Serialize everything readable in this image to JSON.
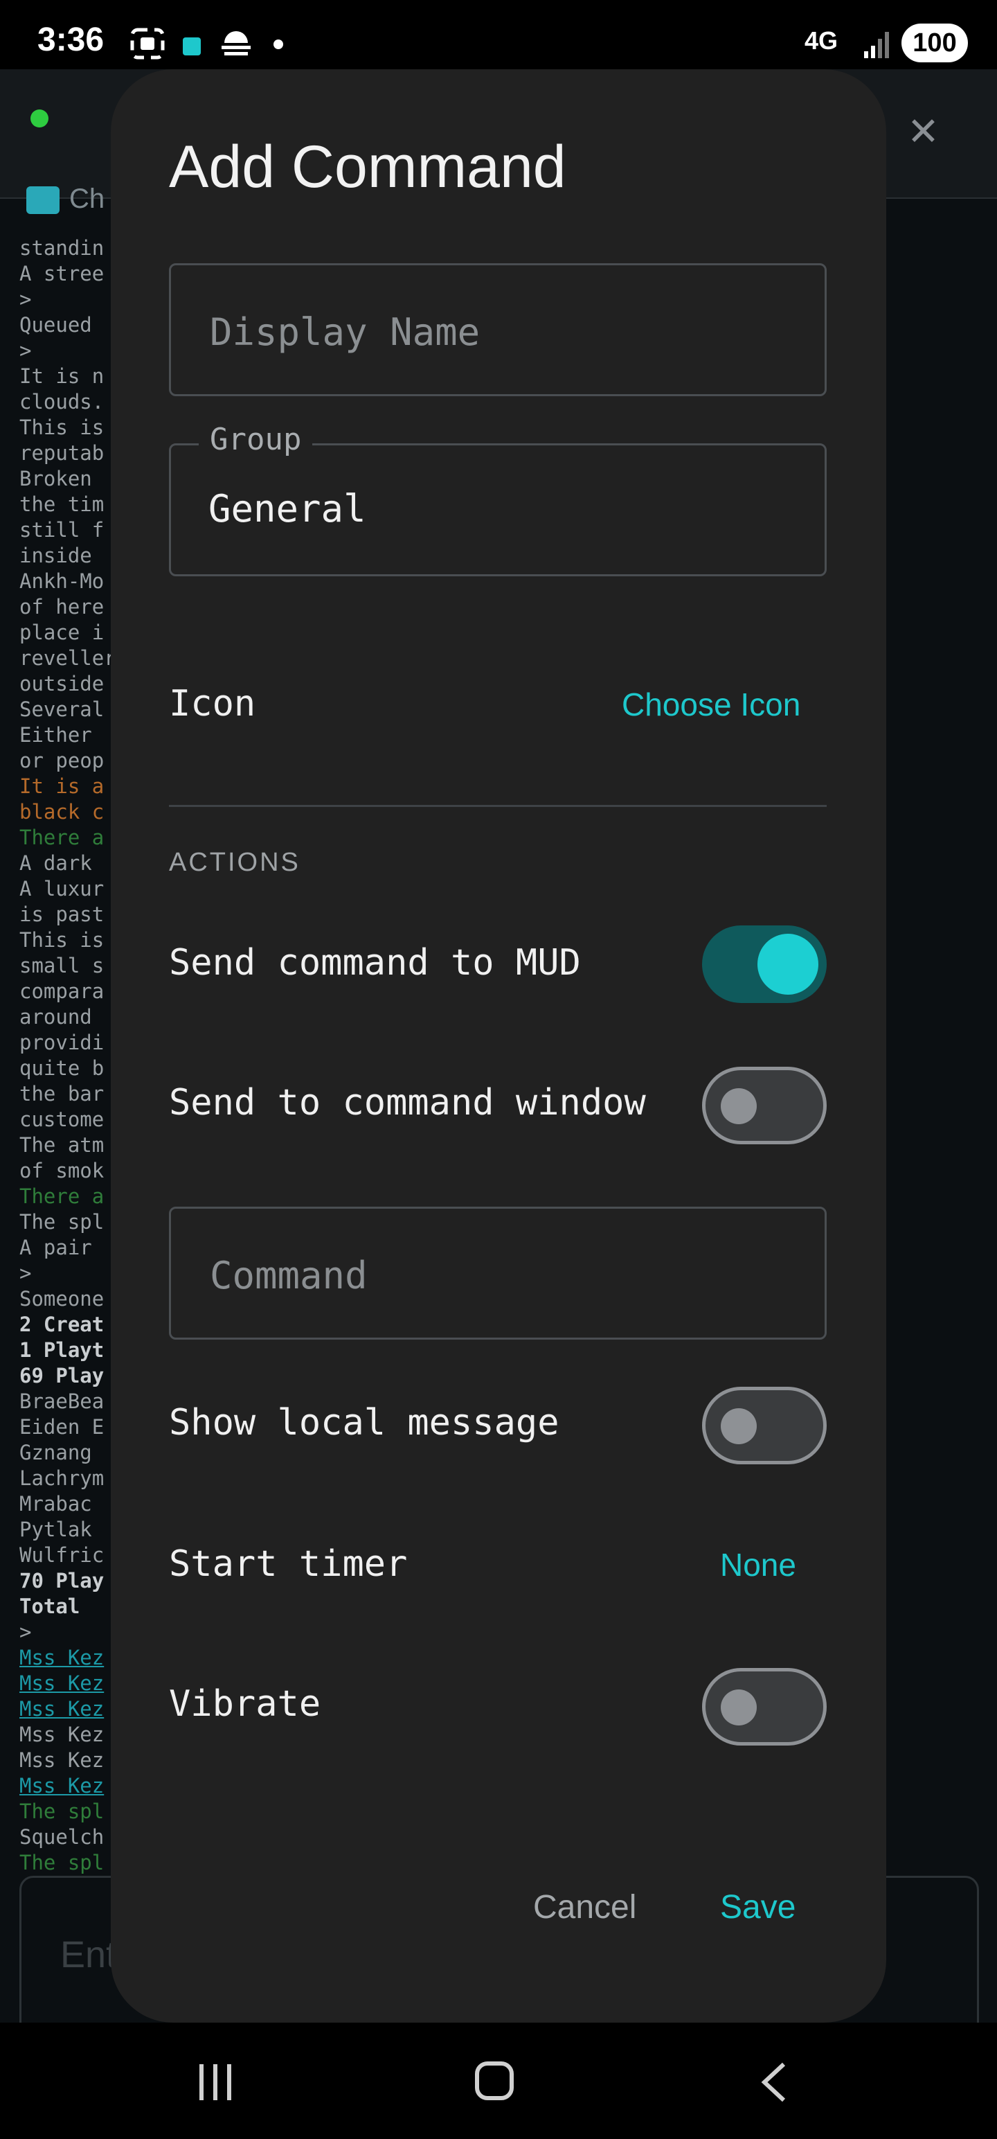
{
  "status_bar": {
    "time": "3:36",
    "network": "4G",
    "battery": "100"
  },
  "background_app": {
    "tab_label": "Ch",
    "input_placeholder": "Ent",
    "terminal_lines": [
      {
        "t": "standin",
        "c": ""
      },
      {
        "t": "A stree",
        "c": ""
      },
      {
        "t": ">",
        "c": ""
      },
      {
        "t": "Queued",
        "c": ""
      },
      {
        "t": ">",
        "c": ""
      },
      {
        "t": "It is n",
        "c": ""
      },
      {
        "t": "clouds.",
        "c": ""
      },
      {
        "t": "This is",
        "c": ""
      },
      {
        "t": "reputab",
        "c": ""
      },
      {
        "t": "Broken",
        "c": ""
      },
      {
        "t": "the tim",
        "c": ""
      },
      {
        "t": "still f",
        "c": ""
      },
      {
        "t": "inside",
        "c": ""
      },
      {
        "t": "Ankh-Mo",
        "c": ""
      },
      {
        "t": "of here",
        "c": ""
      },
      {
        "t": "place i",
        "c": ""
      },
      {
        "t": "reveller",
        "c": ""
      },
      {
        "t": "outside",
        "c": ""
      },
      {
        "t": "Several",
        "c": ""
      },
      {
        "t": "Either",
        "c": ""
      },
      {
        "t": "or peop",
        "c": ""
      },
      {
        "t": "It is a",
        "c": "o"
      },
      {
        "t": "black c",
        "c": "o"
      },
      {
        "t": "There a",
        "c": "g"
      },
      {
        "t": "A dark",
        "c": ""
      },
      {
        "t": "A luxur",
        "c": ""
      },
      {
        "t": "is past",
        "c": ""
      },
      {
        "t": "This is",
        "c": ""
      },
      {
        "t": "small s",
        "c": ""
      },
      {
        "t": "compara",
        "c": ""
      },
      {
        "t": "around",
        "c": ""
      },
      {
        "t": "providi",
        "c": ""
      },
      {
        "t": "quite b",
        "c": ""
      },
      {
        "t": "the bar",
        "c": ""
      },
      {
        "t": "custome",
        "c": ""
      },
      {
        "t": "The atm",
        "c": ""
      },
      {
        "t": "of smok",
        "c": ""
      },
      {
        "t": "There a",
        "c": "g"
      },
      {
        "t": "The spl",
        "c": ""
      },
      {
        "t": "A pair",
        "c": ""
      },
      {
        "t": ">",
        "c": ""
      },
      {
        "t": "Someone",
        "c": ""
      },
      {
        "t": "2 Creat",
        "c": "b"
      },
      {
        "t": "1 Playt",
        "c": "b"
      },
      {
        "t": "69 Play",
        "c": "b"
      },
      {
        "t": "BraeBea",
        "c": ""
      },
      {
        "t": "Eiden E",
        "c": ""
      },
      {
        "t": "Gznang",
        "c": ""
      },
      {
        "t": "Lachrym",
        "c": ""
      },
      {
        "t": "Mrabac",
        "c": ""
      },
      {
        "t": "Pytlak",
        "c": ""
      },
      {
        "t": "Wulfric",
        "c": ""
      },
      {
        "t": "70 Play",
        "c": "b"
      },
      {
        "t": "Total",
        "c": "b"
      },
      {
        "t": ">",
        "c": ""
      },
      {
        "t": "Mss Kez",
        "c": "u"
      },
      {
        "t": "Mss Kez",
        "c": "u"
      },
      {
        "t": "Mss Kez",
        "c": "u"
      },
      {
        "t": "Mss Kez",
        "c": ""
      },
      {
        "t": "Mss Kez",
        "c": ""
      },
      {
        "t": "Mss Kez",
        "c": "u"
      },
      {
        "t": "The spl",
        "c": "g"
      },
      {
        "t": "Squelch",
        "c": ""
      },
      {
        "t": "The spl",
        "c": "g"
      }
    ]
  },
  "dialog": {
    "title": "Add Command",
    "display_name": {
      "placeholder": "Display Name",
      "value": ""
    },
    "group": {
      "label": "Group",
      "value": "General"
    },
    "icon": {
      "label": "Icon",
      "button": "Choose Icon"
    },
    "actions_header": "ACTIONS",
    "send_to_mud": {
      "label": "Send command to MUD",
      "on": true
    },
    "send_to_window": {
      "label": "Send to command window",
      "on": false
    },
    "command": {
      "placeholder": "Command",
      "value": ""
    },
    "show_local_message": {
      "label": "Show local message",
      "on": false
    },
    "start_timer": {
      "label": "Start timer",
      "value": "None"
    },
    "vibrate": {
      "label": "Vibrate",
      "on": false
    },
    "cancel": "Cancel",
    "save": "Save"
  },
  "colors": {
    "accent": "#1ec8cc",
    "dialog_bg": "#212121",
    "toggle_on_track": "#0f5a5c"
  }
}
